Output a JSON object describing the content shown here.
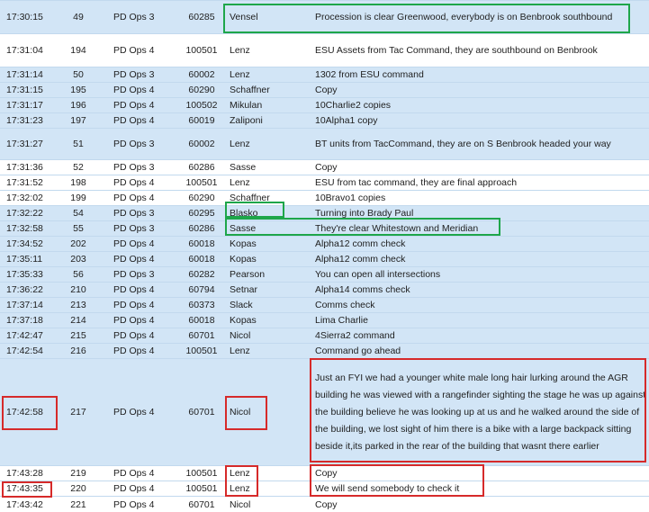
{
  "colors": {
    "row_blue": "#d2e5f6",
    "row_white": "#ffffff",
    "highlight_green": "#1ea64a",
    "highlight_red": "#d62a2a"
  },
  "log": {
    "rows": [
      {
        "time": "17:30:15",
        "seq": "49",
        "channel": "PD Ops 3",
        "unit": "60285",
        "name": "Vensel",
        "message": "Procession is clear Greenwood, everybody is on Benbrook southbound"
      },
      {
        "time": "17:31:04",
        "seq": "194",
        "channel": "PD Ops 4",
        "unit": "100501",
        "name": "Lenz",
        "message": "ESU Assets from Tac Command, they are southbound on Benbrook"
      },
      {
        "time": "17:31:14",
        "seq": "50",
        "channel": "PD Ops 3",
        "unit": "60002",
        "name": "Lenz",
        "message": "1302 from ESU command"
      },
      {
        "time": "17:31:15",
        "seq": "195",
        "channel": "PD Ops 4",
        "unit": "60290",
        "name": "Schaffner",
        "message": "Copy"
      },
      {
        "time": "17:31:17",
        "seq": "196",
        "channel": "PD Ops 4",
        "unit": "100502",
        "name": "Mikulan",
        "message": "10Charlie2 copies"
      },
      {
        "time": "17:31:23",
        "seq": "197",
        "channel": "PD Ops 4",
        "unit": "60019",
        "name": "Zaliponi",
        "message": "10Alpha1 copy"
      },
      {
        "time": "17:31:27",
        "seq": "51",
        "channel": "PD Ops 3",
        "unit": "60002",
        "name": "Lenz",
        "message": "BT units from TacCommand, they are on S Benbrook headed your way"
      },
      {
        "time": "17:31:36",
        "seq": "52",
        "channel": "PD Ops 3",
        "unit": "60286",
        "name": "Sasse",
        "message": "Copy"
      },
      {
        "time": "17:31:52",
        "seq": "198",
        "channel": "PD Ops 4",
        "unit": "100501",
        "name": "Lenz",
        "message": "ESU from tac command, they are final approach"
      },
      {
        "time": "17:32:02",
        "seq": "199",
        "channel": "PD Ops 4",
        "unit": "60290",
        "name": "Schaffner",
        "message": "10Bravo1 copies"
      },
      {
        "time": "17:32:22",
        "seq": "54",
        "channel": "PD Ops 3",
        "unit": "60295",
        "name": "Blasko",
        "message": "Turning into Brady Paul"
      },
      {
        "time": "17:32:58",
        "seq": "55",
        "channel": "PD Ops 3",
        "unit": "60286",
        "name": "Sasse",
        "message": "They're clear Whitestown and Meridian"
      },
      {
        "time": "17:34:52",
        "seq": "202",
        "channel": "PD Ops 4",
        "unit": "60018",
        "name": "Kopas",
        "message": "Alpha12 comm check"
      },
      {
        "time": "17:35:11",
        "seq": "203",
        "channel": "PD Ops 4",
        "unit": "60018",
        "name": "Kopas",
        "message": "Alpha12 comm check"
      },
      {
        "time": "17:35:33",
        "seq": "56",
        "channel": "PD Ops 3",
        "unit": "60282",
        "name": "Pearson",
        "message": "You can open all intersections"
      },
      {
        "time": "17:36:22",
        "seq": "210",
        "channel": "PD Ops 4",
        "unit": "60794",
        "name": "Setnar",
        "message": "Alpha14 comms check"
      },
      {
        "time": "17:37:14",
        "seq": "213",
        "channel": "PD Ops 4",
        "unit": "60373",
        "name": "Slack",
        "message": "Comms check"
      },
      {
        "time": "17:37:18",
        "seq": "214",
        "channel": "PD Ops 4",
        "unit": "60018",
        "name": "Kopas",
        "message": "Lima Charlie"
      },
      {
        "time": "17:42:47",
        "seq": "215",
        "channel": "PD Ops 4",
        "unit": "60701",
        "name": "Nicol",
        "message": "4Sierra2 command"
      },
      {
        "time": "17:42:54",
        "seq": "216",
        "channel": "PD Ops 4",
        "unit": "100501",
        "name": "Lenz",
        "message": "Command go ahead"
      },
      {
        "time": "17:42:58",
        "seq": "217",
        "channel": "PD Ops 4",
        "unit": "60701",
        "name": "Nicol",
        "message": "Just an FYI we had a younger white male long hair lurking around the AGR building he was viewed with a rangefinder sighting the stage he was up against the building believe he was looking up at us and he walked around the side of the building, we lost sight of him there is a bike with a large backpack sitting beside it,its parked in the rear of the building that wasnt there earlier"
      },
      {
        "time": "17:43:28",
        "seq": "219",
        "channel": "PD Ops 4",
        "unit": "100501",
        "name": "Lenz",
        "message": "Copy"
      },
      {
        "time": "17:43:35",
        "seq": "220",
        "channel": "PD Ops 4",
        "unit": "100501",
        "name": "Lenz",
        "message": "We will send somebody to check it"
      },
      {
        "time": "17:43:42",
        "seq": "221",
        "channel": "PD Ops 4",
        "unit": "60701",
        "name": "Nicol",
        "message": "Copy"
      }
    ]
  }
}
